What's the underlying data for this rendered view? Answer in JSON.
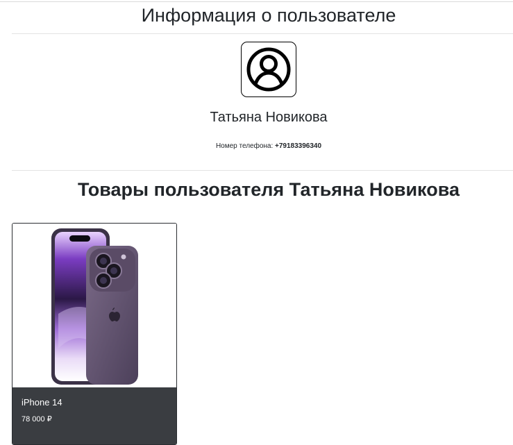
{
  "page": {
    "title": "Информация о пользователе"
  },
  "user": {
    "name": "Татьяна Новикова",
    "phone_label": "Номер телефона:",
    "phone": "+79183396340",
    "avatar_icon": "user-circle-icon"
  },
  "products_section": {
    "title": "Товары пользователя Татьяна Новикова",
    "items": [
      {
        "title": "iPhone 14",
        "price": "78 000 ₽",
        "image_icon": "phone-product-image"
      }
    ]
  },
  "colors": {
    "card_footer": "#3a3d41",
    "phone_frame": "#3b3247",
    "phone_body": "#6b5a78",
    "screen_accent": "#8a4fc8"
  }
}
